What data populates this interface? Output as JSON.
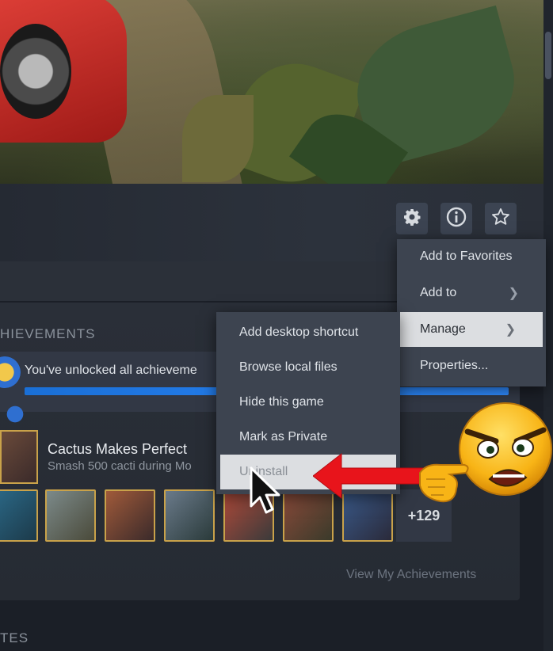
{
  "header_buttons": {
    "settings_icon": "gear-icon",
    "info_icon": "info-icon",
    "favorite_icon": "star-icon"
  },
  "context_menu": {
    "items": [
      {
        "label": "Add to Favorites",
        "submenu": false
      },
      {
        "label": "Add to",
        "submenu": true
      },
      {
        "label": "Manage",
        "submenu": true,
        "highlighted": true
      },
      {
        "label": "Properties..."
      }
    ]
  },
  "submenu": {
    "items": [
      {
        "label": "Add desktop shortcut"
      },
      {
        "label": "Browse local files"
      },
      {
        "label": "Hide this game"
      },
      {
        "label": "Mark as Private"
      },
      {
        "label": "Uninstall",
        "highlighted": true
      }
    ]
  },
  "achievements": {
    "section_title": "HIEVEMENTS",
    "banner_text": "You've unlocked all achieveme",
    "progress_percent": 100,
    "latest": {
      "name": "Cactus Makes Perfect",
      "description": "Smash 500 cacti during Mo"
    },
    "more_count": "+129",
    "view_link": "View My Achievements"
  },
  "bottom_section_title": "TES",
  "colors": {
    "accent_blue": "#1a9fff",
    "menu_bg": "#3d4450",
    "highlight": "#dcdee1",
    "gold_border": "#c9a24a",
    "arrow_red": "#e8141b"
  }
}
